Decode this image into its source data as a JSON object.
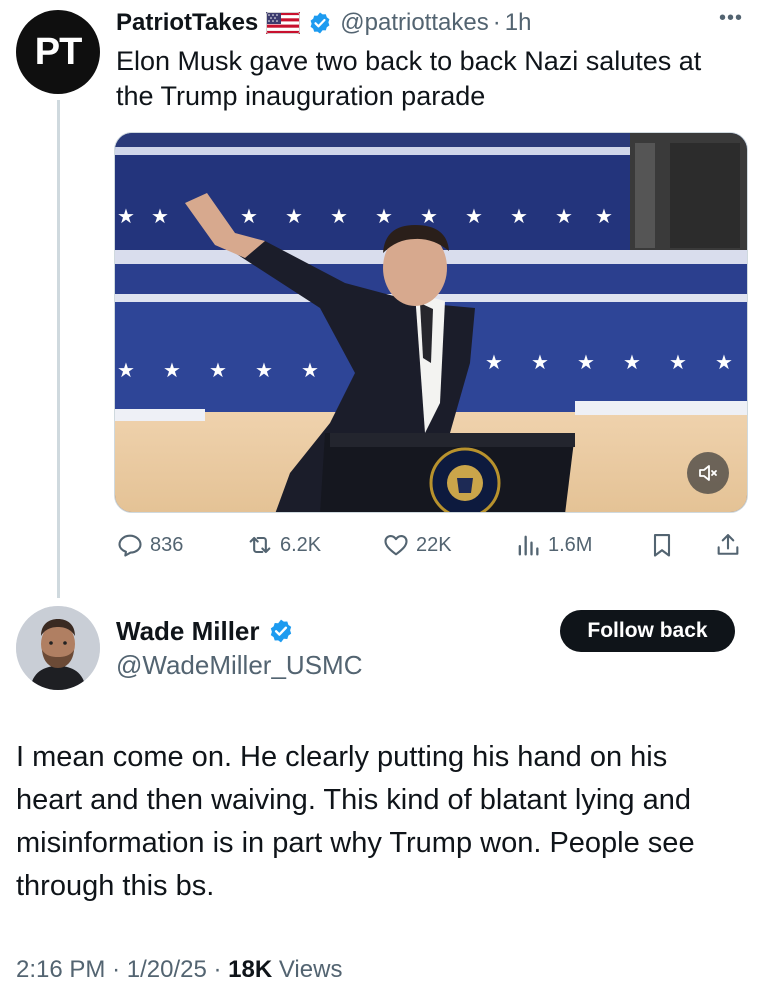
{
  "quoted_tweet": {
    "avatar_initials": "PT",
    "name": "PatriotTakes",
    "flag_icon": "us-flag-icon",
    "handle": "@patriottakes",
    "separator": "·",
    "time": "1h",
    "text": "Elon Musk gave two back to back Nazi salutes at the Trump inauguration parade",
    "stats": {
      "replies": "836",
      "reposts": "6.2K",
      "likes": "22K",
      "views": "1.6M"
    }
  },
  "main_tweet": {
    "name": "Wade Miller",
    "handle": "@WadeMiller_USMC",
    "follow_label": "Follow back",
    "text": "I mean come on.  He clearly putting his hand on his heart and then waiving.  This kind of blatant lying and misinformation is in part why Trump won.  People see through this bs.",
    "time": "2:16 PM",
    "separator_1": "·",
    "date": "1/20/25",
    "separator_2": "·",
    "views_count": "18K",
    "views_label": "Views"
  },
  "colors": {
    "verified_blue": "#1d9bf0",
    "secondary_text": "#536471",
    "primary_text": "#0f1419",
    "thread_line": "#cfd9de"
  }
}
